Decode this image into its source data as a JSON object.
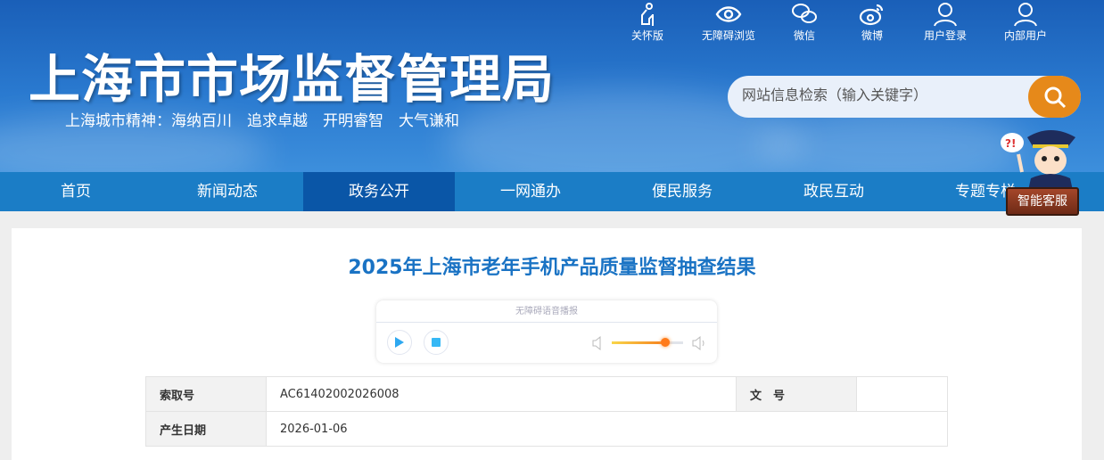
{
  "header": {
    "logo": "上海市市场监督管理局",
    "slogan": "上海城市精神：海纳百川　追求卓越　开明睿智　大气谦和",
    "top_links": [
      {
        "label": "关怀版",
        "icon": "elderly-icon"
      },
      {
        "label": "无障碍浏览",
        "icon": "eye-icon"
      },
      {
        "label": "微信",
        "icon": "wechat-icon"
      },
      {
        "label": "微博",
        "icon": "weibo-icon"
      },
      {
        "label": "用户登录",
        "icon": "user-icon"
      },
      {
        "label": "内部用户",
        "icon": "user-icon"
      }
    ],
    "search_placeholder": "网站信息检索（输入关键字）"
  },
  "nav": [
    {
      "label": "首页"
    },
    {
      "label": "新闻动态"
    },
    {
      "label": "政务公开",
      "active": true
    },
    {
      "label": "一网通办"
    },
    {
      "label": "便民服务"
    },
    {
      "label": "政民互动"
    },
    {
      "label": "专题专栏"
    }
  ],
  "assistant": {
    "label": "智能客服"
  },
  "article": {
    "title": "2025年上海市老年手机产品质量监督抽查结果"
  },
  "player": {
    "label": "无障碍语音播报",
    "volume": 0.75
  },
  "meta": [
    {
      "k1": "索取号",
      "v1": "AC61402002026008",
      "k2": "文　号",
      "v2": ""
    },
    {
      "k1": "产生日期",
      "v1": "2026-01-06"
    }
  ],
  "colors": {
    "accent": "#1a73c4",
    "nav": "#1b7dc6",
    "nav_active": "#0a56a7",
    "search_btn": "#e6891a"
  }
}
